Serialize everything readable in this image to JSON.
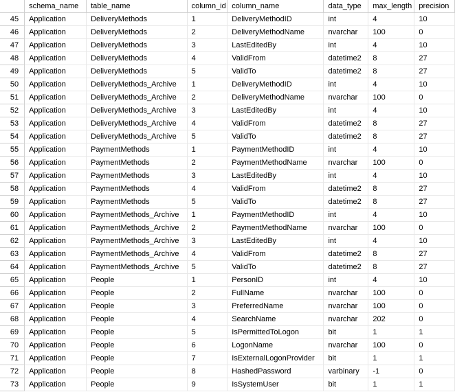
{
  "columns": {
    "schema_name": "schema_name",
    "table_name": "table_name",
    "column_id": "column_id",
    "column_name": "column_name",
    "data_type": "data_type",
    "max_length": "max_length",
    "precision": "precision"
  },
  "rows": [
    {
      "n": "45",
      "schema": "Application",
      "table": "DeliveryMethods",
      "cid": "1",
      "cname": "DeliveryMethodID",
      "dtype": "int",
      "mlen": "4",
      "prec": "10"
    },
    {
      "n": "46",
      "schema": "Application",
      "table": "DeliveryMethods",
      "cid": "2",
      "cname": "DeliveryMethodName",
      "dtype": "nvarchar",
      "mlen": "100",
      "prec": "0"
    },
    {
      "n": "47",
      "schema": "Application",
      "table": "DeliveryMethods",
      "cid": "3",
      "cname": "LastEditedBy",
      "dtype": "int",
      "mlen": "4",
      "prec": "10"
    },
    {
      "n": "48",
      "schema": "Application",
      "table": "DeliveryMethods",
      "cid": "4",
      "cname": "ValidFrom",
      "dtype": "datetime2",
      "mlen": "8",
      "prec": "27"
    },
    {
      "n": "49",
      "schema": "Application",
      "table": "DeliveryMethods",
      "cid": "5",
      "cname": "ValidTo",
      "dtype": "datetime2",
      "mlen": "8",
      "prec": "27"
    },
    {
      "n": "50",
      "schema": "Application",
      "table": "DeliveryMethods_Archive",
      "cid": "1",
      "cname": "DeliveryMethodID",
      "dtype": "int",
      "mlen": "4",
      "prec": "10"
    },
    {
      "n": "51",
      "schema": "Application",
      "table": "DeliveryMethods_Archive",
      "cid": "2",
      "cname": "DeliveryMethodName",
      "dtype": "nvarchar",
      "mlen": "100",
      "prec": "0"
    },
    {
      "n": "52",
      "schema": "Application",
      "table": "DeliveryMethods_Archive",
      "cid": "3",
      "cname": "LastEditedBy",
      "dtype": "int",
      "mlen": "4",
      "prec": "10"
    },
    {
      "n": "53",
      "schema": "Application",
      "table": "DeliveryMethods_Archive",
      "cid": "4",
      "cname": "ValidFrom",
      "dtype": "datetime2",
      "mlen": "8",
      "prec": "27"
    },
    {
      "n": "54",
      "schema": "Application",
      "table": "DeliveryMethods_Archive",
      "cid": "5",
      "cname": "ValidTo",
      "dtype": "datetime2",
      "mlen": "8",
      "prec": "27"
    },
    {
      "n": "55",
      "schema": "Application",
      "table": "PaymentMethods",
      "cid": "1",
      "cname": "PaymentMethodID",
      "dtype": "int",
      "mlen": "4",
      "prec": "10"
    },
    {
      "n": "56",
      "schema": "Application",
      "table": "PaymentMethods",
      "cid": "2",
      "cname": "PaymentMethodName",
      "dtype": "nvarchar",
      "mlen": "100",
      "prec": "0"
    },
    {
      "n": "57",
      "schema": "Application",
      "table": "PaymentMethods",
      "cid": "3",
      "cname": "LastEditedBy",
      "dtype": "int",
      "mlen": "4",
      "prec": "10"
    },
    {
      "n": "58",
      "schema": "Application",
      "table": "PaymentMethods",
      "cid": "4",
      "cname": "ValidFrom",
      "dtype": "datetime2",
      "mlen": "8",
      "prec": "27"
    },
    {
      "n": "59",
      "schema": "Application",
      "table": "PaymentMethods",
      "cid": "5",
      "cname": "ValidTo",
      "dtype": "datetime2",
      "mlen": "8",
      "prec": "27"
    },
    {
      "n": "60",
      "schema": "Application",
      "table": "PaymentMethods_Archive",
      "cid": "1",
      "cname": "PaymentMethodID",
      "dtype": "int",
      "mlen": "4",
      "prec": "10"
    },
    {
      "n": "61",
      "schema": "Application",
      "table": "PaymentMethods_Archive",
      "cid": "2",
      "cname": "PaymentMethodName",
      "dtype": "nvarchar",
      "mlen": "100",
      "prec": "0"
    },
    {
      "n": "62",
      "schema": "Application",
      "table": "PaymentMethods_Archive",
      "cid": "3",
      "cname": "LastEditedBy",
      "dtype": "int",
      "mlen": "4",
      "prec": "10"
    },
    {
      "n": "63",
      "schema": "Application",
      "table": "PaymentMethods_Archive",
      "cid": "4",
      "cname": "ValidFrom",
      "dtype": "datetime2",
      "mlen": "8",
      "prec": "27"
    },
    {
      "n": "64",
      "schema": "Application",
      "table": "PaymentMethods_Archive",
      "cid": "5",
      "cname": "ValidTo",
      "dtype": "datetime2",
      "mlen": "8",
      "prec": "27"
    },
    {
      "n": "65",
      "schema": "Application",
      "table": "People",
      "cid": "1",
      "cname": "PersonID",
      "dtype": "int",
      "mlen": "4",
      "prec": "10"
    },
    {
      "n": "66",
      "schema": "Application",
      "table": "People",
      "cid": "2",
      "cname": "FullName",
      "dtype": "nvarchar",
      "mlen": "100",
      "prec": "0"
    },
    {
      "n": "67",
      "schema": "Application",
      "table": "People",
      "cid": "3",
      "cname": "PreferredName",
      "dtype": "nvarchar",
      "mlen": "100",
      "prec": "0"
    },
    {
      "n": "68",
      "schema": "Application",
      "table": "People",
      "cid": "4",
      "cname": "SearchName",
      "dtype": "nvarchar",
      "mlen": "202",
      "prec": "0"
    },
    {
      "n": "69",
      "schema": "Application",
      "table": "People",
      "cid": "5",
      "cname": "IsPermittedToLogon",
      "dtype": "bit",
      "mlen": "1",
      "prec": "1"
    },
    {
      "n": "70",
      "schema": "Application",
      "table": "People",
      "cid": "6",
      "cname": "LogonName",
      "dtype": "nvarchar",
      "mlen": "100",
      "prec": "0"
    },
    {
      "n": "71",
      "schema": "Application",
      "table": "People",
      "cid": "7",
      "cname": "IsExternalLogonProvider",
      "dtype": "bit",
      "mlen": "1",
      "prec": "1"
    },
    {
      "n": "72",
      "schema": "Application",
      "table": "People",
      "cid": "8",
      "cname": "HashedPassword",
      "dtype": "varbinary",
      "mlen": "-1",
      "prec": "0"
    },
    {
      "n": "73",
      "schema": "Application",
      "table": "People",
      "cid": "9",
      "cname": "IsSystemUser",
      "dtype": "bit",
      "mlen": "1",
      "prec": "1"
    }
  ]
}
